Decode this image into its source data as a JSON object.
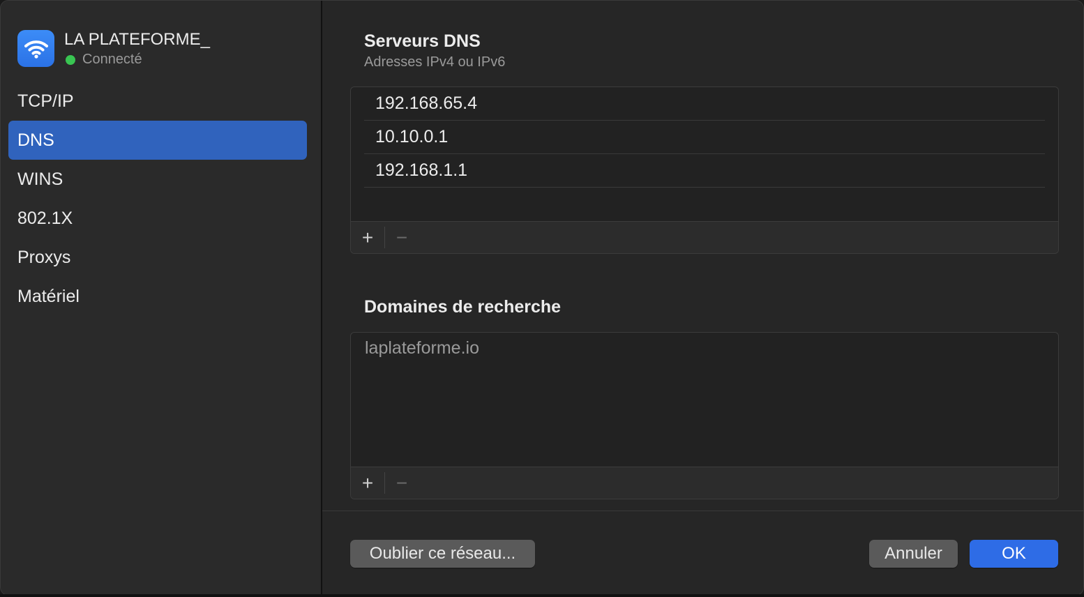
{
  "network": {
    "name": "LA PLATEFORME_",
    "status": "Connecté",
    "icon": "wifi-icon",
    "status_color": "#39c552"
  },
  "sidebar": {
    "items": [
      {
        "label": "TCP/IP",
        "selected": false
      },
      {
        "label": "DNS",
        "selected": true
      },
      {
        "label": "WINS",
        "selected": false
      },
      {
        "label": "802.1X",
        "selected": false
      },
      {
        "label": "Proxys",
        "selected": false
      },
      {
        "label": "Matériel",
        "selected": false
      }
    ]
  },
  "dns_servers": {
    "title": "Serveurs DNS",
    "subtitle": "Adresses IPv4 ou IPv6",
    "entries": [
      "192.168.65.4",
      "10.10.0.1",
      "192.168.1.1"
    ],
    "add_label": "+",
    "remove_label": "−"
  },
  "search_domains": {
    "title": "Domaines de recherche",
    "entries": [
      "laplateforme.io"
    ],
    "add_label": "+",
    "remove_label": "−"
  },
  "footer": {
    "forget_label": "Oublier ce réseau...",
    "cancel_label": "Annuler",
    "ok_label": "OK"
  },
  "colors": {
    "accent": "#2e6ce6",
    "selection": "#3063bd"
  }
}
